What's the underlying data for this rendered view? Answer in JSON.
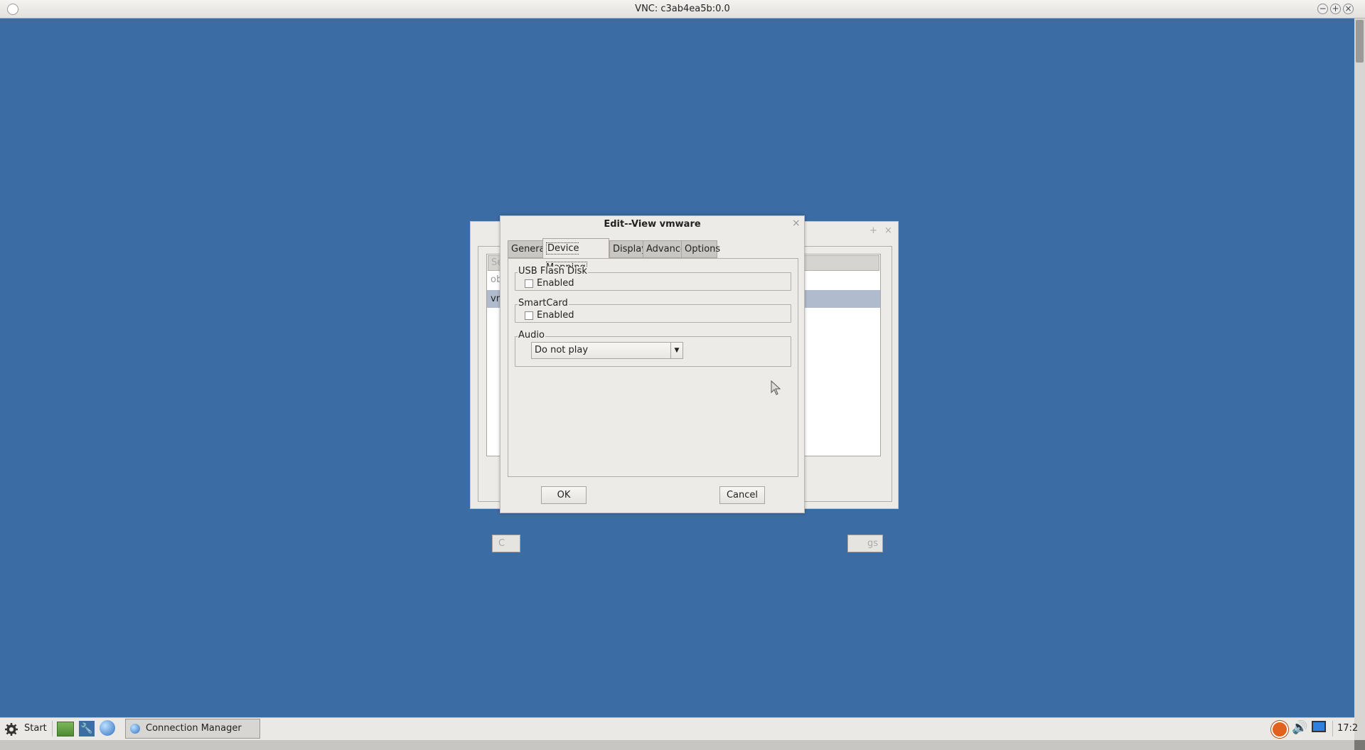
{
  "vnc": {
    "title": "VNC: c3ab4ea5b:0.0",
    "buttons": [
      "−",
      "+",
      "×"
    ]
  },
  "background_window": {
    "list_header": "Ses",
    "rows": [
      "obl",
      "vmv"
    ],
    "left_button": "C",
    "right_button": "gs",
    "title_buttons": [
      "+",
      "×"
    ]
  },
  "dialog": {
    "title": "Edit--View vmware",
    "close": "×",
    "tabs": [
      {
        "label": "General",
        "active": false
      },
      {
        "label": "Device Mapping",
        "active": true
      },
      {
        "label": "Display",
        "active": false
      },
      {
        "label": "Advance",
        "active": false
      },
      {
        "label": "Options",
        "active": false
      }
    ],
    "usb": {
      "label": "USB Flash Disk",
      "checkbox_label": "Enabled",
      "checked": false
    },
    "smartcard": {
      "label": "SmartCard",
      "checkbox_label": "Enabled",
      "checked": false
    },
    "audio": {
      "label": "Audio",
      "selected": "Do not play"
    },
    "ok": "OK",
    "cancel": "Cancel"
  },
  "taskbar": {
    "start": "Start",
    "task": "Connection Manager",
    "clock": "17:2"
  }
}
